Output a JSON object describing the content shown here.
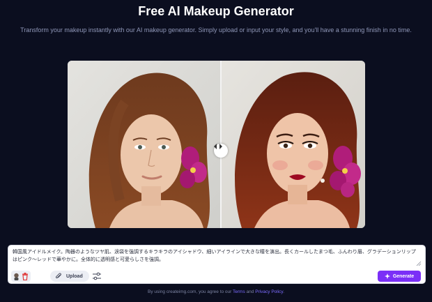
{
  "header": {
    "title": "Free AI Makeup Generator",
    "subtitle": "Transform your makeup instantly with our AI makeup generator. Simply upload or input your style, and you'll have a stunning finish in no time."
  },
  "compare": {
    "before_label": "",
    "after_label": ""
  },
  "prompt": {
    "text": "韓国風アイドルメイク。陶器のようなツヤ肌、涙袋を強調するキラキラのアイシャドウ、細いアイラインで大きな瞳を演出。長くカールしたまつ毛、ふんわり眉、グラデーションリップはピンク〜レッドで華やかに。全体的に透明感と可愛らしさを強調。"
  },
  "toolbar": {
    "upload_label": "Upload",
    "generate_label": "Generate"
  },
  "footer": {
    "prefix": "By using createimg.com, you agree to our",
    "terms": "Terms",
    "and": "and",
    "privacy": "Privacy Policy",
    "suffix": "."
  },
  "colors": {
    "background": "#0b0e1f",
    "accent": "#7b2ff7",
    "link": "#7c6cff"
  },
  "icons": [
    "face-icon",
    "trash-icon",
    "paperclip-icon",
    "sliders-icon",
    "sparkle-icon",
    "compare-arrows-icon"
  ]
}
